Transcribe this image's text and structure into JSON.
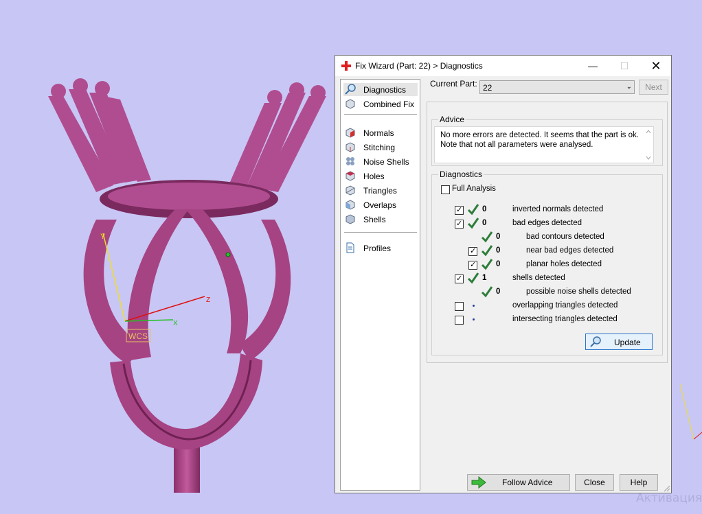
{
  "viewport": {
    "axis_labels": {
      "y": "Y",
      "z": "Z",
      "x": "X"
    },
    "wcs_label": "WCS",
    "watermark": "Активация"
  },
  "dialog": {
    "title": "Fix Wizard (Part: 22) > Diagnostics",
    "nav": {
      "diagnostics": "Diagnostics",
      "combined_fix": "Combined Fix",
      "normals": "Normals",
      "stitching": "Stitching",
      "noise_shells": "Noise Shells",
      "holes": "Holes",
      "triangles": "Triangles",
      "overlaps": "Overlaps",
      "shells": "Shells",
      "profiles": "Profiles"
    },
    "current_part_label": "Current Part:",
    "current_part_value": "22",
    "next_label": "Next",
    "advice": {
      "title": "Advice",
      "text": "No more errors are detected. It seems that the part is ok. Note that not all parameters were analysed."
    },
    "diagnostics": {
      "title": "Diagnostics",
      "full_analysis": "Full Analysis",
      "rows": [
        {
          "count": "0",
          "label": "inverted normals detected"
        },
        {
          "count": "0",
          "label": "bad edges detected"
        },
        {
          "count": "0",
          "label": "bad contours detected"
        },
        {
          "count": "0",
          "label": "near bad edges detected"
        },
        {
          "count": "0",
          "label": "planar holes detected"
        },
        {
          "count": "1",
          "label": "shells detected"
        },
        {
          "count": "0",
          "label": "possible noise shells detected"
        },
        {
          "count": "",
          "label": "overlapping triangles detected"
        },
        {
          "count": "",
          "label": "intersecting triangles detected"
        }
      ],
      "update_label": "Update"
    },
    "buttons": {
      "follow_advice": "Follow Advice",
      "close": "Close",
      "help": "Help"
    }
  },
  "colors": {
    "background": "#c8c6f4",
    "part": "#a64383",
    "check": "#2d7d3a"
  }
}
